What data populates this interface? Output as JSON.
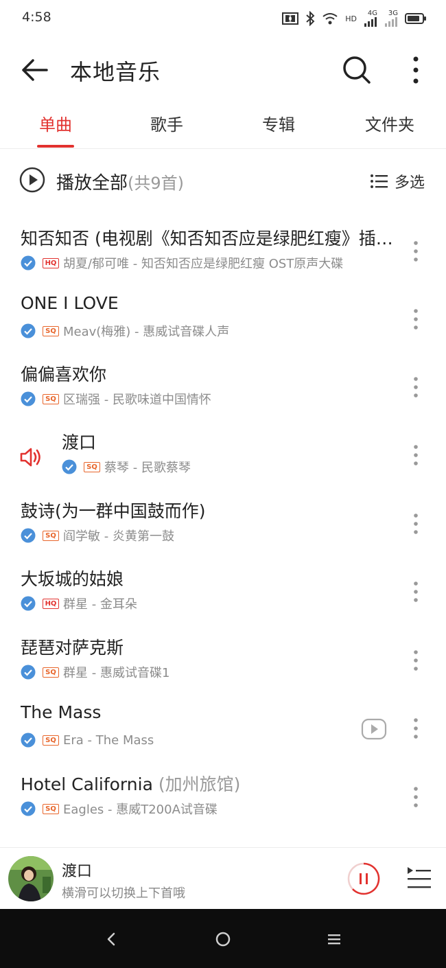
{
  "status_bar": {
    "time": "4:58",
    "net_a": "4G",
    "net_b": "3G",
    "hd": "HD"
  },
  "appbar": {
    "title": "本地音乐"
  },
  "tabs": [
    {
      "label": "单曲",
      "active": true
    },
    {
      "label": "歌手",
      "active": false
    },
    {
      "label": "专辑",
      "active": false
    },
    {
      "label": "文件夹",
      "active": false
    }
  ],
  "play_all": {
    "label": "播放全部",
    "count": "(共9首)",
    "multi_select": "多选"
  },
  "songs": [
    {
      "title": "知否知否 (电视剧《知否知否应是绿肥红瘦》插曲)",
      "title_alt": "",
      "quality": "HQ",
      "meta": "胡夏/郁可唯 - 知否知否应是绿肥红瘦 OST原声大碟"
    },
    {
      "title": "ONE I LOVE",
      "title_alt": "",
      "quality": "SQ",
      "meta": "Meav(梅雅) - 惠威试音碟人声"
    },
    {
      "title": "偏偏喜欢你",
      "title_alt": "",
      "quality": "SQ",
      "meta": "区瑞强 - 民歌味道中国情怀"
    },
    {
      "title": "渡口",
      "title_alt": "",
      "quality": "SQ",
      "meta": "蔡琴 - 民歌蔡琴",
      "playing": true
    },
    {
      "title": "鼓诗(为一群中国鼓而作)",
      "title_alt": "",
      "quality": "SQ",
      "meta": "阎学敏 - 炎黄第一鼓"
    },
    {
      "title": "大坂城的姑娘",
      "title_alt": "",
      "quality": "HQ",
      "meta": "群星 - 金耳朵"
    },
    {
      "title": "琵琶对萨克斯",
      "title_alt": "",
      "quality": "SQ",
      "meta": "群星 - 惠威试音碟1"
    },
    {
      "title": "The Mass",
      "title_alt": "",
      "quality": "SQ",
      "meta": "Era - The Mass",
      "has_mv": true
    },
    {
      "title": "Hotel California",
      "title_alt": "(加州旅馆)",
      "quality": "SQ",
      "meta": "Eagles - 惠威T200A试音碟"
    }
  ],
  "mini_player": {
    "title": "渡口",
    "subtitle": "横滑可以切换上下首哦"
  },
  "colors": {
    "accent": "#e2322f",
    "sq_badge": "#e8652a",
    "check": "#4a90d9",
    "secondary_text": "#8c8c8c"
  },
  "icons": [
    "back-arrow-icon",
    "search-icon",
    "more-vert-icon",
    "play-circle-icon",
    "list-icon",
    "check-circle-icon",
    "speaker-icon",
    "mv-play-icon",
    "pause-icon",
    "playlist-icon",
    "nav-back-icon",
    "nav-home-icon",
    "nav-menu-icon"
  ]
}
